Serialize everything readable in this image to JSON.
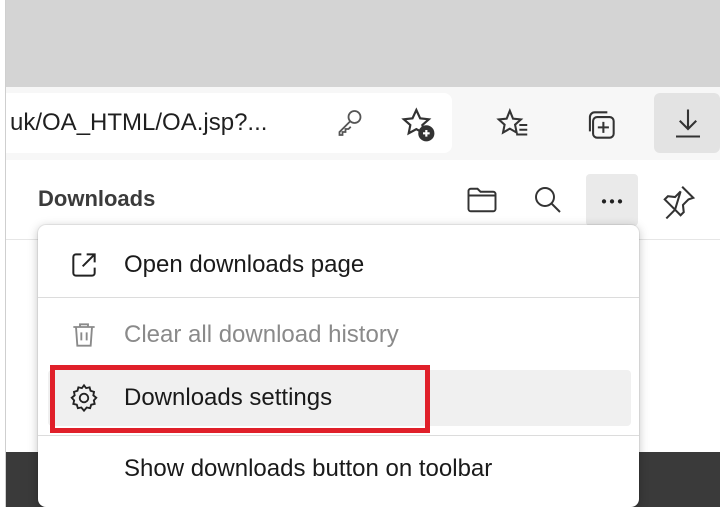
{
  "browser": {
    "address_bar": {
      "url_text": "uk/OA_HTML/OA.jsp?..."
    },
    "toolbar_icons": [
      "key-icon",
      "add-favorite-icon",
      "favorites-icon",
      "collections-icon",
      "download-icon"
    ]
  },
  "downloads_panel": {
    "title": "Downloads",
    "header_icons": [
      "open-folder-icon",
      "search-icon",
      "more-options-icon",
      "pin-icon"
    ]
  },
  "context_menu": {
    "items": [
      {
        "label": "Open downloads page",
        "icon": "open-external-icon",
        "enabled": true
      },
      {
        "label": "Clear all download history",
        "icon": "trash-icon",
        "enabled": false
      },
      {
        "label": "Downloads settings",
        "icon": "gear-icon",
        "enabled": true,
        "highlighted": true
      },
      {
        "label": "Show downloads button on toolbar",
        "icon": "",
        "enabled": true
      }
    ]
  },
  "colors": {
    "highlight_border": "#e0202a",
    "titlebar": "#d4d4d4",
    "toolbar": "#f7f7f7"
  }
}
